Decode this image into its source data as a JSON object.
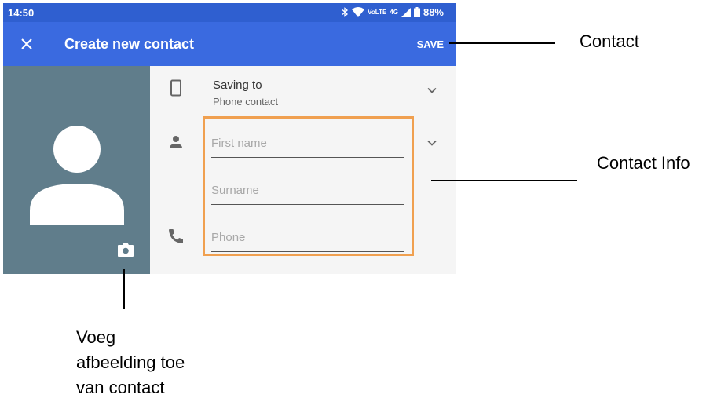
{
  "status_bar": {
    "time": "14:50",
    "network_badge": "VoLTE",
    "network": "4G",
    "battery": "88%"
  },
  "app_bar": {
    "close_icon": "close-icon",
    "title": "Create new contact",
    "save_label": "SAVE"
  },
  "photo": {
    "avatar_icon": "person-silhouette-icon",
    "camera_icon": "camera-icon",
    "background_color": "#607d8b"
  },
  "form": {
    "saving_to_label": "Saving to",
    "saving_to_value": "Phone contact",
    "first_name_placeholder": "First name",
    "surname_placeholder": "Surname",
    "phone_placeholder": "Phone"
  },
  "annotations": {
    "contact": "Contact",
    "contact_info": "Contact Info",
    "photo_line1": "Voeg",
    "photo_line2": "afbeelding toe",
    "photo_line3": "van contact"
  },
  "colors": {
    "status_bar": "#2f5fd0",
    "app_bar": "#3a6ae0",
    "highlight": "#f0a050"
  }
}
